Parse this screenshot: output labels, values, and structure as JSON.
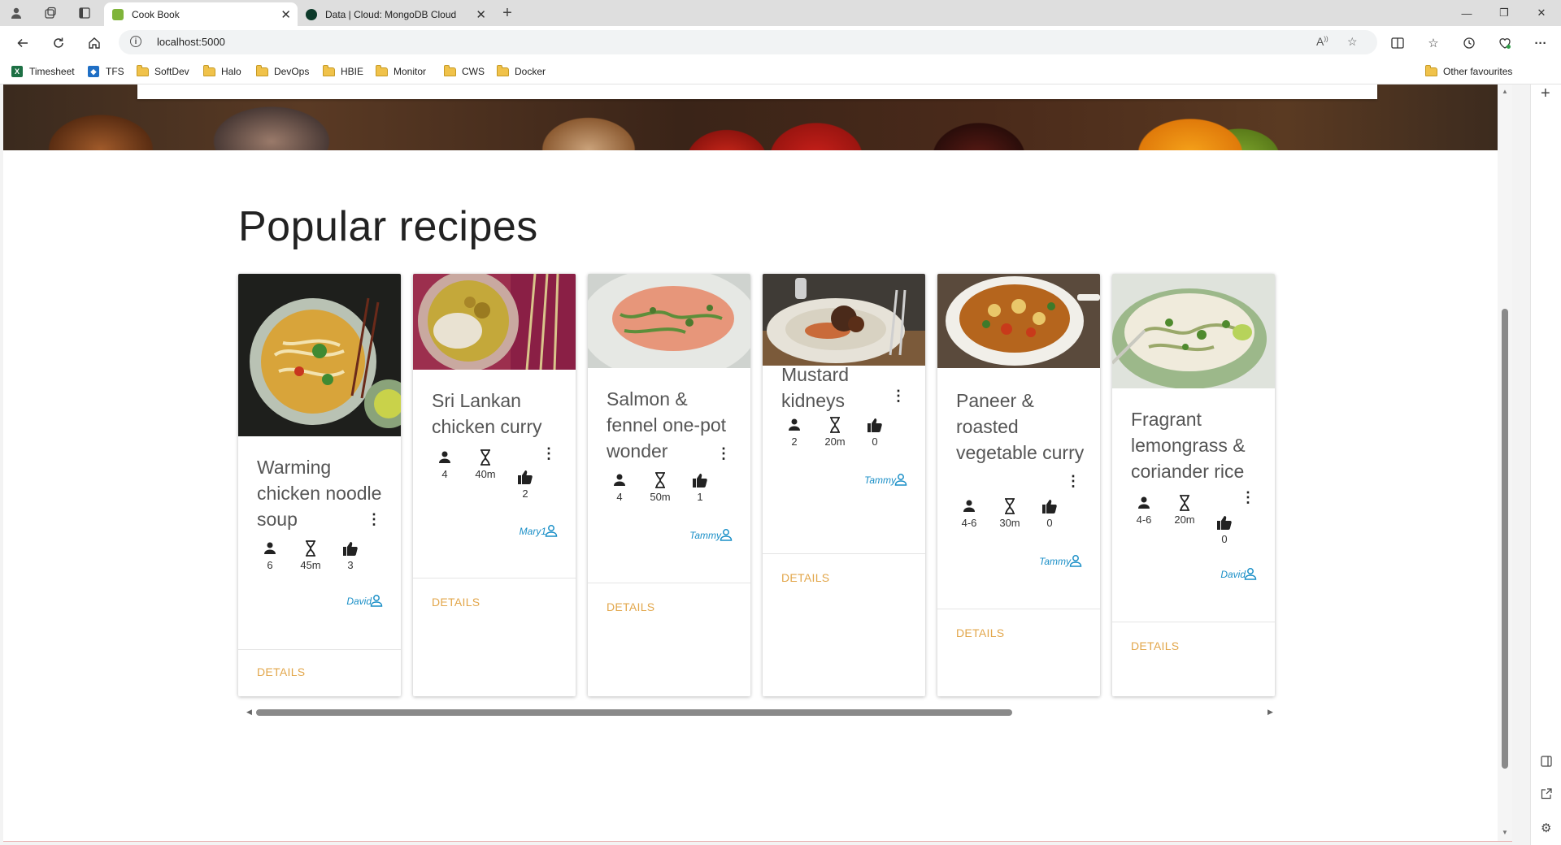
{
  "browser": {
    "tabs": [
      {
        "title": "Cook Book",
        "active": true
      },
      {
        "title": "Data | Cloud: MongoDB Cloud",
        "active": false
      }
    ],
    "url": "localhost:5000",
    "bookmarks": [
      "Timesheet",
      "TFS",
      "SoftDev",
      "Halo",
      "DevOps",
      "HBIE",
      "Monitor",
      "CWS",
      "Docker"
    ],
    "other_favourites": "Other favourites"
  },
  "page": {
    "section_title": "Popular recipes",
    "details_label": "DETAILS",
    "recipes": [
      {
        "title": "Warming chicken noodle soup",
        "serves": "6",
        "time": "45m",
        "likes": "3",
        "author": "David"
      },
      {
        "title": "Sri Lankan chicken curry",
        "serves": "4",
        "time": "40m",
        "likes": "2",
        "author": "Mary1"
      },
      {
        "title": "Salmon & fennel one-pot wonder",
        "serves": "4",
        "time": "50m",
        "likes": "1",
        "author": "Tammy"
      },
      {
        "title": "Mustard kidneys",
        "serves": "2",
        "time": "20m",
        "likes": "0",
        "author": "Tammy"
      },
      {
        "title": "Paneer & roasted vegetable curry",
        "serves": "4-6",
        "time": "30m",
        "likes": "0",
        "author": "Tammy"
      },
      {
        "title": "Fragrant lemongrass & coriander rice",
        "serves": "4-6",
        "time": "20m",
        "likes": "0",
        "author": "David"
      }
    ]
  },
  "colors": {
    "accent_details": "#e2a64a",
    "author_blue": "#1a8fc7"
  },
  "icons": [
    "person-icon",
    "hourglass-icon",
    "thumbs-up-icon",
    "more-vert-icon",
    "user-outline-icon"
  ]
}
